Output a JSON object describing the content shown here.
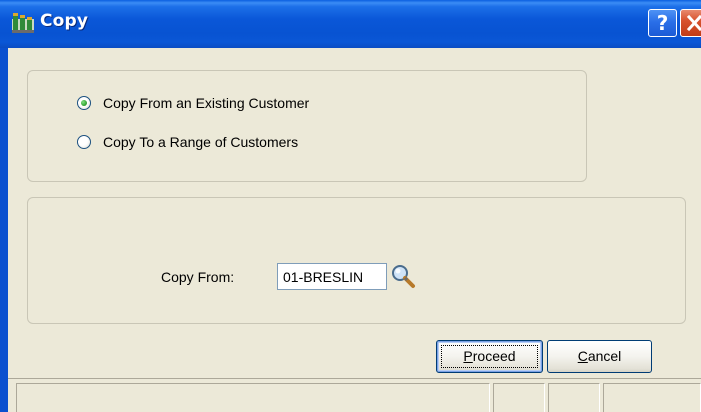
{
  "window": {
    "title": "Copy",
    "app_icon": "mas90-app-icon",
    "help_glyph": "?",
    "help_button": "help-icon",
    "close_button": "close-icon"
  },
  "copy_mode": {
    "options": [
      {
        "label": "Copy From an Existing Customer",
        "checked": true
      },
      {
        "label": "Copy To a Range of Customers",
        "checked": false
      }
    ]
  },
  "copy_from": {
    "label": "Copy From:",
    "value": "01-BRESLIN",
    "lookup_icon": "magnifier-lookup-icon"
  },
  "buttons": {
    "proceed": {
      "accel": "P",
      "rest": "roceed"
    },
    "cancel": {
      "accel": "C",
      "rest": "ancel"
    }
  },
  "colors": {
    "titlebar": "#0a57d8",
    "face": "#ece9d8",
    "button_border": "#003c74",
    "radio_dot": "#2a9d2a"
  }
}
